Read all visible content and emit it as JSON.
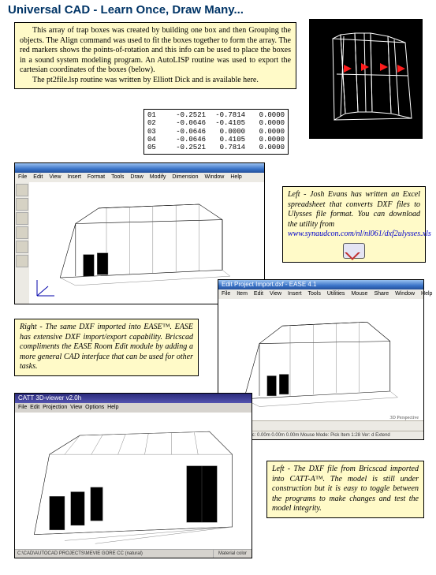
{
  "title": "Universal CAD - Learn Once, Draw Many...",
  "intro": {
    "para1": "This array of trap boxes was created by building one box and then Grouping the objects. The Align command was used to fit the boxes together to form the array. The red markers shows the points-of-rotation and this info can be used to place the boxes in a sound system modeling program. An AutoLISP routine was used to export the cartesian coordinates of the boxes (below).",
    "para2": "The pt2file.lsp routine was written by Elliott Dick and is available here."
  },
  "coord_table": {
    "rows": [
      {
        "id": "01",
        "x": "-0.2521",
        "y": "-0.7814",
        "z": "0.0000"
      },
      {
        "id": "02",
        "x": "-0.0646",
        "y": "-0.4105",
        "z": "0.0000"
      },
      {
        "id": "03",
        "x": "-0.0646",
        "y": "0.0000",
        "z": "0.0000"
      },
      {
        "id": "04",
        "x": "-0.0646",
        "y": "0.4105",
        "z": "0.0000"
      },
      {
        "id": "05",
        "x": "-0.2521",
        "y": "0.7814",
        "z": "0.0000"
      }
    ]
  },
  "ease_caption": {
    "text": "Left - Josh Evans has written an Excel spreadsheet that converts DXF files to Ulysses file format. You can download the utility from",
    "link": "www.synaudcon.com/nl/nl061/dxf2ulysses.xls"
  },
  "right_caption": "Right - The same DXF imported into EASE™. EASE has extensive DXF import/export capability. Bricscad compliments the EASE Room Edit module by adding a more general CAD interface that can be used for other tasks.",
  "left_catt_caption": "Left - The DXF file from Bricscad imported into CATT-A™. The model is still under construction but it is easy to toggle between the programs to make changes and test the model integrity.",
  "bricscad_window": {
    "title": "",
    "menu": [
      "File",
      "Edit",
      "View",
      "Insert",
      "Format",
      "Tools",
      "Draw",
      "Modify",
      "Dimension",
      "Window",
      "Help"
    ]
  },
  "ease_window": {
    "title": "Edit Project Import.dxf - EASE 4.1",
    "menu": [
      "File",
      "Item",
      "Edit",
      "View",
      "Insert",
      "Tools",
      "Utilities",
      "Mouse",
      "Share",
      "Window",
      "Help"
    ],
    "status": "Item   Picked Loc:   0.00m   0.00m   0.00m  Mouse Mode:  Pick Item   1:28   Ver:   d   Extend",
    "tag": "3D Perspective"
  },
  "catt_window": {
    "title": "CATT 3D-viewer v2.0h",
    "menu": [
      "File",
      "Edit",
      "Projection",
      "View",
      "Options",
      "Help"
    ],
    "status_left": "C:\\CAD\\AUTOCAD PROJECTS\\MEVIE GORE CC (natural)",
    "status_right": "Material color"
  }
}
